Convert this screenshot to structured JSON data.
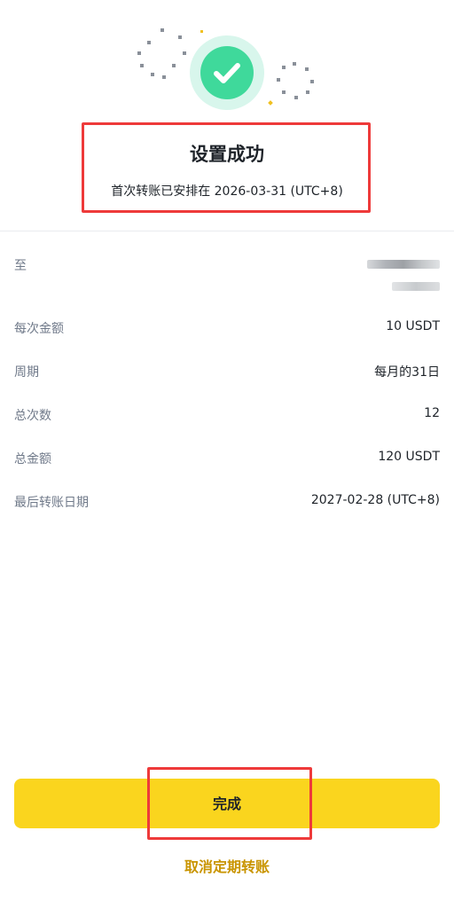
{
  "result": {
    "title": "设置成功",
    "subtitle": "首次转账已安排在 2026-03-31 (UTC+8)"
  },
  "details": [
    {
      "label": "至",
      "value": ""
    },
    {
      "label": "每次金额",
      "value": "10 USDT"
    },
    {
      "label": "周期",
      "value": "每月的31日"
    },
    {
      "label": "总次数",
      "value": "12"
    },
    {
      "label": "总金额",
      "value": "120 USDT"
    },
    {
      "label": "最后转账日期",
      "value": "2027-02-28 (UTC+8)"
    }
  ],
  "actions": {
    "done_label": "完成",
    "cancel_label": "取消定期转账"
  },
  "icons": {
    "success": "check-circle-icon",
    "recipient": "redacted-recipient"
  },
  "colors": {
    "accent": "#FAD51E",
    "link": "#C99400",
    "success": "#3FD99B",
    "success_bg": "#D8F6EC",
    "highlight": "#EE3A3A",
    "label_gray": "#707A8A",
    "text": "#1E2329"
  }
}
